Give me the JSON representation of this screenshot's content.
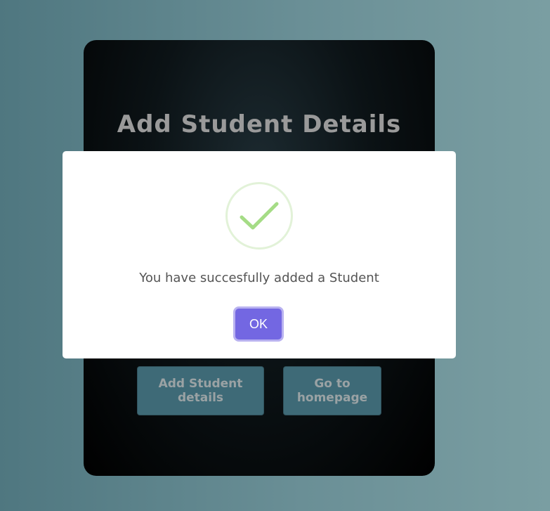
{
  "card": {
    "title": "Add Student Details",
    "add_button_label": "Add Student details",
    "home_button_label": "Go to homepage"
  },
  "dialog": {
    "icon": "success-check-icon",
    "message": "You have succesfully added a Student",
    "ok_label": "OK",
    "colors": {
      "check": "#a5dc86",
      "circle": "#e2f2d8",
      "ok_button": "#7367e2"
    }
  }
}
